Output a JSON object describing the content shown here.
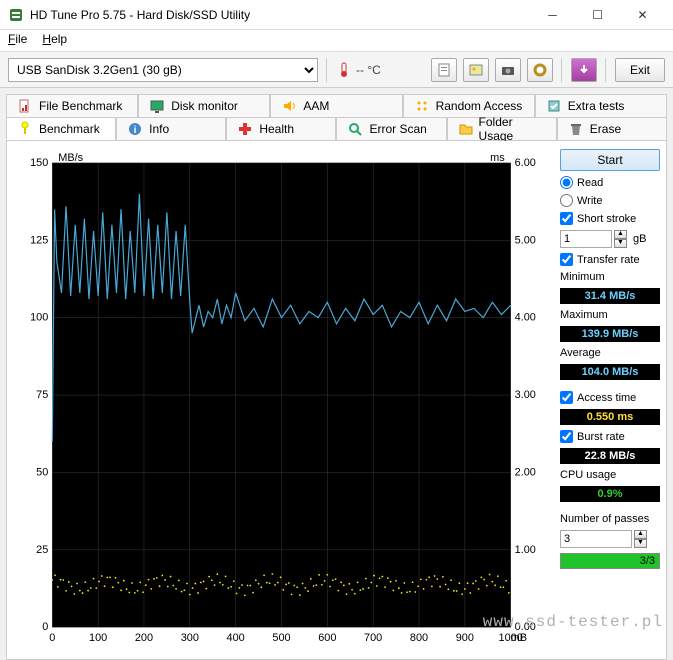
{
  "window": {
    "title": "HD Tune Pro 5.75 - Hard Disk/SSD Utility"
  },
  "menu": {
    "file": "File",
    "help": "Help"
  },
  "toolbar": {
    "drive": "USB SanDisk 3.2Gen1 (30 gB)",
    "temp": "-- °C",
    "exit": "Exit"
  },
  "tabs_row1": [
    {
      "label": "File Benchmark"
    },
    {
      "label": "Disk monitor"
    },
    {
      "label": "AAM"
    },
    {
      "label": "Random Access"
    },
    {
      "label": "Extra tests"
    }
  ],
  "tabs_row2": [
    {
      "label": "Benchmark"
    },
    {
      "label": "Info"
    },
    {
      "label": "Health"
    },
    {
      "label": "Error Scan"
    },
    {
      "label": "Folder Usage"
    },
    {
      "label": "Erase"
    }
  ],
  "side": {
    "start": "Start",
    "read": "Read",
    "write": "Write",
    "short_stroke": "Short stroke",
    "short_stroke_val": "1",
    "short_stroke_unit": "gB",
    "transfer_rate": "Transfer rate",
    "min_lbl": "Minimum",
    "min_val": "31.4 MB/s",
    "max_lbl": "Maximum",
    "max_val": "139.9 MB/s",
    "avg_lbl": "Average",
    "avg_val": "104.0 MB/s",
    "access_lbl": "Access time",
    "access_val": "0.550 ms",
    "burst_lbl": "Burst rate",
    "burst_val": "22.8 MB/s",
    "cpu_lbl": "CPU usage",
    "cpu_val": "0.9%",
    "passes_lbl": "Number of passes",
    "passes_val": "3",
    "progress": "3/3"
  },
  "chart_data": {
    "type": "line",
    "title": "",
    "y1_label": "MB/s",
    "y2_label": "ms",
    "x_label": "mB",
    "y1_ticks": [
      0,
      25,
      50,
      75,
      100,
      125,
      150
    ],
    "y2_ticks": [
      "0.00",
      "1.00",
      "2.00",
      "3.00",
      "4.00",
      "5.00",
      "6.00"
    ],
    "x_ticks": [
      0,
      100,
      200,
      300,
      400,
      500,
      600,
      700,
      800,
      900,
      1000
    ],
    "x_range": [
      0,
      1000
    ],
    "y1_range": [
      0,
      150
    ],
    "y2_range": [
      0,
      6
    ],
    "series": [
      {
        "name": "Transfer rate (MB/s)",
        "axis": "y1",
        "color": "#4aa8d8",
        "x": [
          0,
          5,
          10,
          20,
          30,
          40,
          50,
          60,
          70,
          80,
          90,
          100,
          110,
          120,
          130,
          140,
          150,
          160,
          170,
          180,
          190,
          200,
          210,
          220,
          230,
          240,
          250,
          260,
          270,
          280,
          290,
          300,
          305,
          310,
          320,
          330,
          340,
          350,
          360,
          370,
          380,
          390,
          400,
          420,
          440,
          460,
          480,
          500,
          520,
          540,
          560,
          580,
          600,
          620,
          640,
          660,
          680,
          700,
          720,
          740,
          760,
          780,
          800,
          820,
          840,
          860,
          880,
          900,
          920,
          940,
          960,
          980,
          1000
        ],
        "values": [
          60,
          135,
          118,
          108,
          136,
          107,
          130,
          108,
          132,
          106,
          128,
          107,
          134,
          106,
          130,
          108,
          135,
          106,
          128,
          108,
          140,
          107,
          132,
          106,
          130,
          108,
          134,
          106,
          128,
          107,
          130,
          105,
          95,
          98,
          104,
          97,
          102,
          100,
          106,
          98,
          104,
          100,
          108,
          99,
          103,
          97,
          106,
          100,
          104,
          98,
          102,
          100,
          105,
          98,
          103,
          99,
          106,
          101,
          104,
          97,
          102,
          100,
          105,
          98,
          104,
          99,
          106,
          102,
          103,
          100,
          105,
          101,
          104
        ]
      },
      {
        "name": "Access time (ms)",
        "axis": "y2",
        "color": "#e8e820",
        "x": [
          0,
          50,
          100,
          150,
          200,
          250,
          300,
          350,
          400,
          450,
          500,
          550,
          600,
          650,
          700,
          750,
          800,
          850,
          900,
          950,
          1000
        ],
        "values": [
          0.55,
          0.54,
          0.56,
          0.53,
          0.57,
          0.55,
          0.54,
          0.56,
          0.55,
          0.53,
          0.56,
          0.55,
          0.54,
          0.57,
          0.55,
          0.53,
          0.56,
          0.55,
          0.54,
          0.56,
          0.55
        ]
      }
    ]
  },
  "watermark": "www.ssd-tester.pl"
}
